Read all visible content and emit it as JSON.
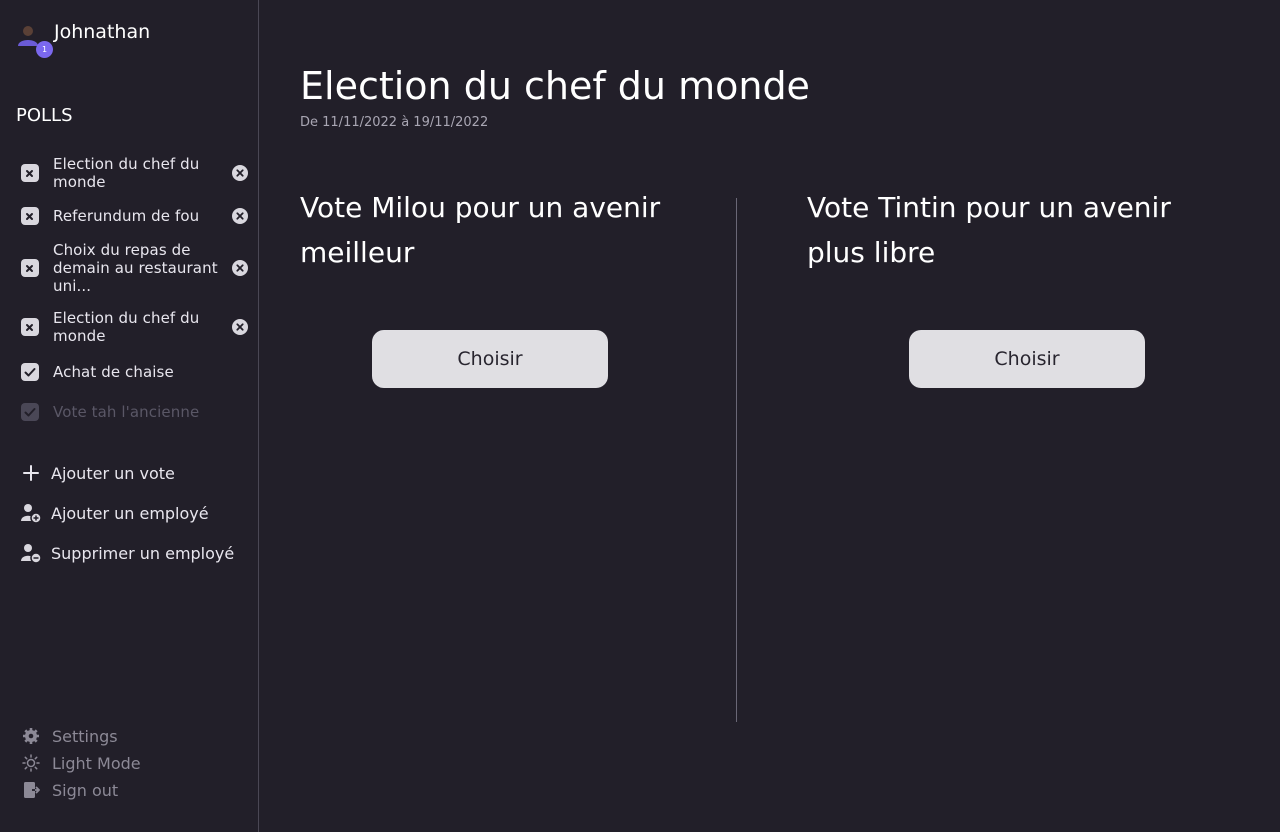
{
  "user": {
    "name": "Johnathan",
    "badge": "1"
  },
  "sidebar": {
    "section_title": "POLLS",
    "polls": [
      {
        "label": "Election du chef du monde",
        "status": "closed",
        "icon": "close-icon"
      },
      {
        "label": "Referundum de fou",
        "status": "closed",
        "icon": "close-icon"
      },
      {
        "label": "Choix du repas de demain au restaurant uni...",
        "status": "closed",
        "icon": "close-icon"
      },
      {
        "label": "Election du chef du monde",
        "status": "closed",
        "icon": "close-icon"
      },
      {
        "label": "Achat de chaise",
        "status": "voted"
      },
      {
        "label": "Vote tah l'ancienne",
        "status": "voted-faded"
      }
    ],
    "actions": [
      {
        "label": "Ajouter un vote",
        "icon": "plus-icon"
      },
      {
        "label": "Ajouter un employé",
        "icon": "user-add-icon"
      },
      {
        "label": "Supprimer un employé",
        "icon": "user-remove-icon"
      }
    ],
    "bottom": [
      {
        "label": "Settings",
        "icon": "gear-icon"
      },
      {
        "label": "Light Mode",
        "icon": "sun-icon"
      },
      {
        "label": "Sign out",
        "icon": "sign-out-icon"
      }
    ]
  },
  "main": {
    "title": "Election du chef du monde",
    "subtitle": "De 11/11/2022 à 19/11/2022",
    "options": [
      {
        "text": "Vote Milou pour un avenir meilleur",
        "button": "Choisir"
      },
      {
        "text": "Vote Tintin pour un avenir plus libre",
        "button": "Choisir"
      }
    ]
  },
  "colors": {
    "background": "#221f29",
    "accent": "#7b68ee",
    "button_bg": "#e0dfe3",
    "muted_text": "#8c8996"
  }
}
